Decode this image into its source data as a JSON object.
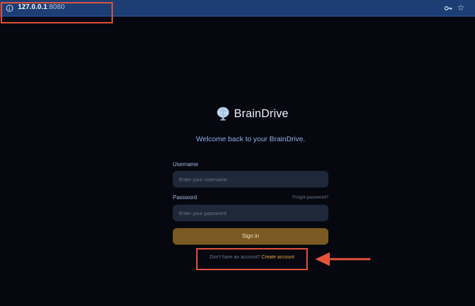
{
  "browser": {
    "url_host": "127.0.0.1",
    "url_port": ":8080",
    "star_glyph": "☆",
    "icons": [
      "info-icon",
      "key-icon",
      "star-icon"
    ]
  },
  "brand": {
    "name": "BrainDrive",
    "icon": "brain-icon"
  },
  "login": {
    "welcome": "Welcome back to your BrainDrive.",
    "username_label": "Username",
    "username_placeholder": "Enter your username",
    "password_label": "Password",
    "forgot_link": "Forgot password?",
    "password_placeholder": "Enter your password",
    "signin_label": "Sign in",
    "no_account_text": "Don't have an account?",
    "create_account_link": "Create account"
  },
  "annotation": {
    "highlight_color": "#e5533d"
  },
  "colors": {
    "background": "#07080f",
    "urlbar": "#1c3e74",
    "field_bg": "#1f2839",
    "accent_button": "#7a5a22",
    "link_accent": "#e9a93f",
    "label_text": "#9fbbe6"
  }
}
